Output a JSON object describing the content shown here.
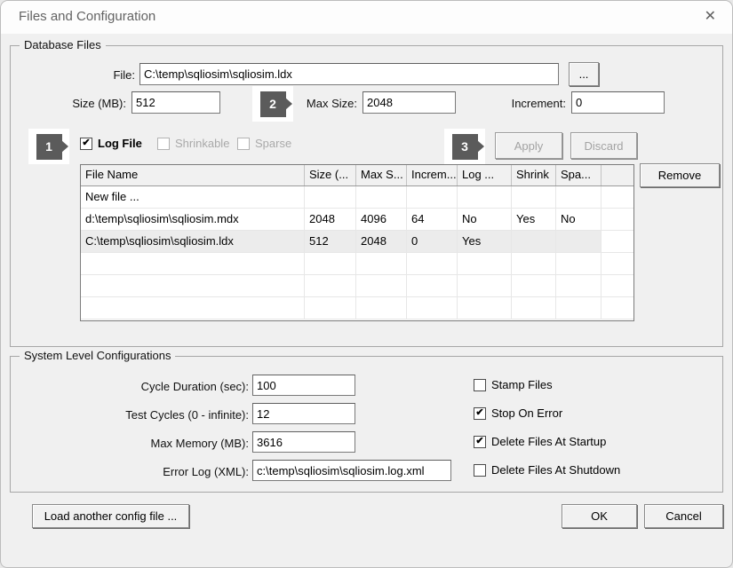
{
  "title_bar": {
    "title": "Files and Configuration",
    "close_icon": "✕"
  },
  "colors": {
    "badge_gray": "#5b5b5b",
    "selection_gray": "#ececec",
    "dialog_bg": "#f0f0f0",
    "titlebar_bg": "#fdfdfd"
  },
  "database_files": {
    "legend": "Database Files",
    "file_label": "File:",
    "file_value": "C:\\temp\\sqliosim\\sqliosim.ldx",
    "browse_label": "...",
    "size_label": "Size (MB):",
    "size_value": "512",
    "max_size_label": "Max Size:",
    "max_size_value": "2048",
    "increment_label": "Increment:",
    "increment_value": "0",
    "badges": {
      "one": "1",
      "two": "2",
      "three": "3"
    },
    "checkboxes": [
      {
        "label": "Log File",
        "checked": true,
        "enabled": true
      },
      {
        "label": "Shrinkable",
        "checked": false,
        "enabled": false
      },
      {
        "label": "Sparse",
        "checked": false,
        "enabled": false
      }
    ],
    "apply_label": "Apply",
    "apply_enabled": false,
    "discard_label": "Discard",
    "discard_enabled": false,
    "remove_label": "Remove",
    "table": {
      "columns": [
        "File Name",
        "Size (...",
        "Max S...",
        "Increm...",
        "Log ...",
        "Shrink",
        "Spa...",
        ""
      ],
      "rows": [
        [
          "New file ...",
          "",
          "",
          "",
          "",
          "",
          ""
        ],
        [
          "d:\\temp\\sqliosim\\sqliosim.mdx",
          "2048",
          "4096",
          "64",
          "No",
          "Yes",
          "No"
        ],
        [
          "C:\\temp\\sqliosim\\sqliosim.ldx",
          "512",
          "2048",
          "0",
          "Yes",
          "",
          ""
        ]
      ],
      "selected_row_index": 2,
      "empty_row_count": 3
    }
  },
  "system_config": {
    "legend": "System Level Configurations",
    "fields": [
      {
        "label": "Cycle Duration (sec):",
        "value": "100"
      },
      {
        "label": "Test Cycles (0 - infinite):",
        "value": "12"
      },
      {
        "label": "Max Memory (MB):",
        "value": "3616"
      },
      {
        "label": "Error Log (XML):",
        "value": "c:\\temp\\sqliosim\\sqliosim.log.xml"
      }
    ],
    "checkboxes": [
      {
        "label": "Stamp Files",
        "checked": false,
        "enabled": true
      },
      {
        "label": "Stop On Error",
        "checked": true,
        "enabled": true
      },
      {
        "label": "Delete Files At Startup",
        "checked": true,
        "enabled": true
      },
      {
        "label": "Delete Files At Shutdown",
        "checked": false,
        "enabled": true
      }
    ]
  },
  "footer": {
    "load_config_label": "Load another config file ...",
    "ok_label": "OK",
    "cancel_label": "Cancel"
  }
}
